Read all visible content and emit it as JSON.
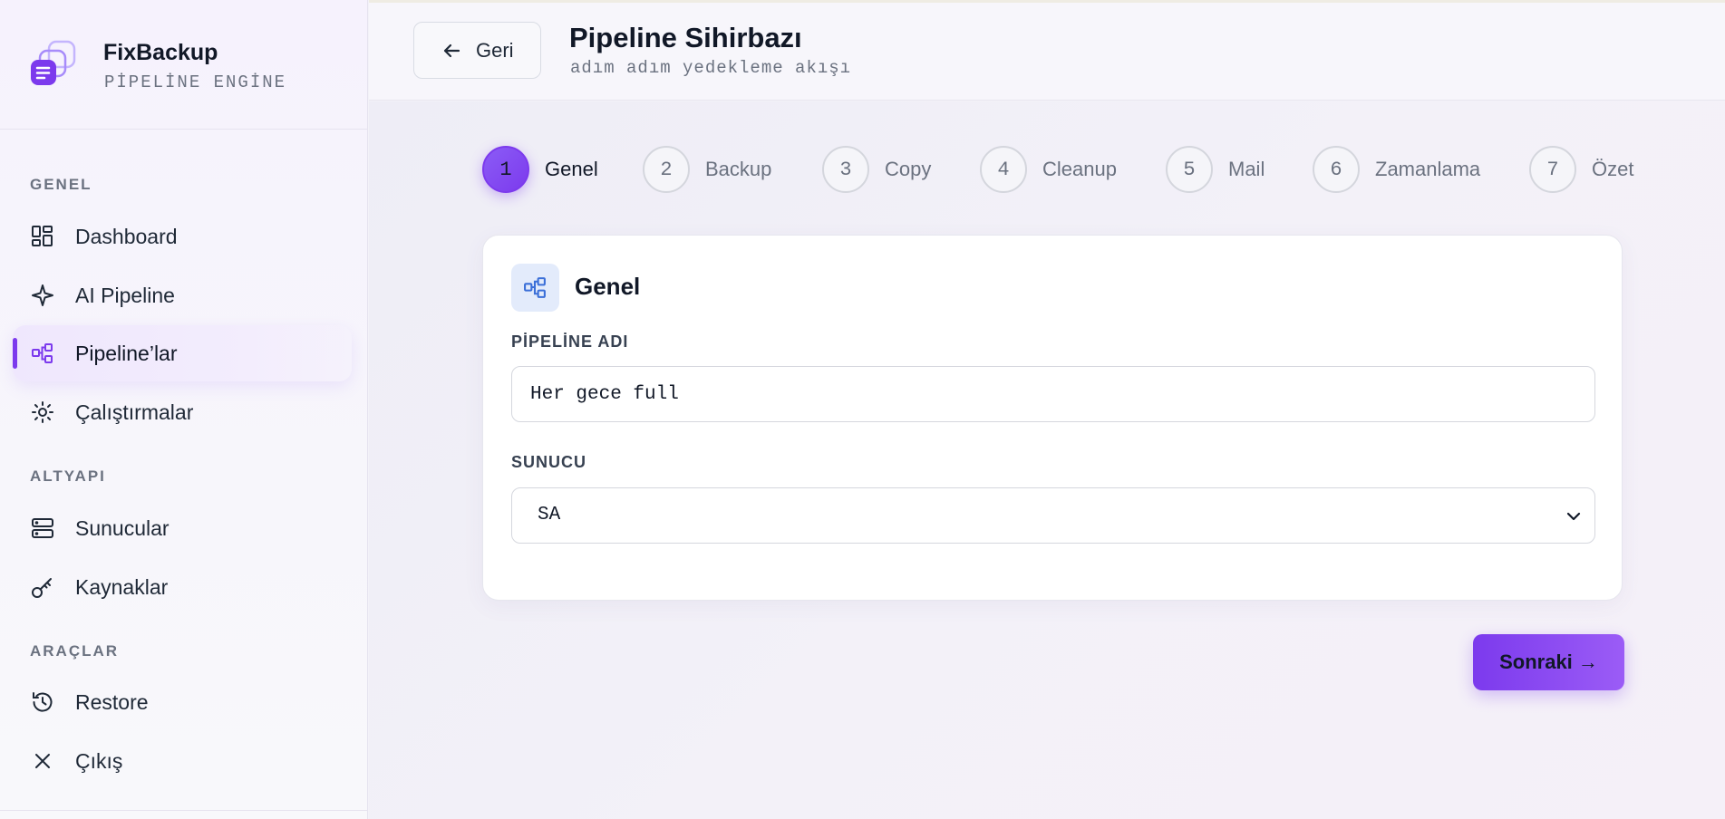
{
  "brand": {
    "name": "FixBackup",
    "subtitle": "PİPELİNE ENGİNE"
  },
  "sidebar": {
    "sections": [
      {
        "label": "GENEL"
      },
      {
        "label": "ALTYAPI"
      },
      {
        "label": "ARAÇLAR"
      }
    ],
    "items": [
      {
        "label": "Dashboard",
        "icon": "dashboard-icon"
      },
      {
        "label": "AI Pipeline",
        "icon": "sparkle-icon"
      },
      {
        "label": "Pipeline’lar",
        "icon": "pipeline-icon",
        "active": true
      },
      {
        "label": "Çalıştırmalar",
        "icon": "sun-icon"
      },
      {
        "label": "Sunucular",
        "icon": "server-icon"
      },
      {
        "label": "Kaynaklar",
        "icon": "key-icon"
      },
      {
        "label": "Restore",
        "icon": "history-icon"
      },
      {
        "label": "Çıkış",
        "icon": "close-icon"
      }
    ]
  },
  "header": {
    "back_label": "Geri",
    "title": "Pipeline Sihirbazı",
    "subtitle": "adım adım yedekleme akışı"
  },
  "steps": [
    {
      "number": "1",
      "label": "Genel",
      "active": true
    },
    {
      "number": "2",
      "label": "Backup"
    },
    {
      "number": "3",
      "label": "Copy"
    },
    {
      "number": "4",
      "label": "Cleanup"
    },
    {
      "number": "5",
      "label": "Mail"
    },
    {
      "number": "6",
      "label": "Zamanlama"
    },
    {
      "number": "7",
      "label": "Özet"
    }
  ],
  "card": {
    "title": "Genel",
    "pipeline_name_label": "PİPELİNE ADI",
    "pipeline_name_value": "Her gece full",
    "server_label": "SUNUCU",
    "server_value": "SA"
  },
  "next_label": "Sonraki →",
  "colors": {
    "accent": "#7c3aed",
    "accent_light": "#8b5cf6",
    "icon_blue": "#3b6fd8"
  }
}
